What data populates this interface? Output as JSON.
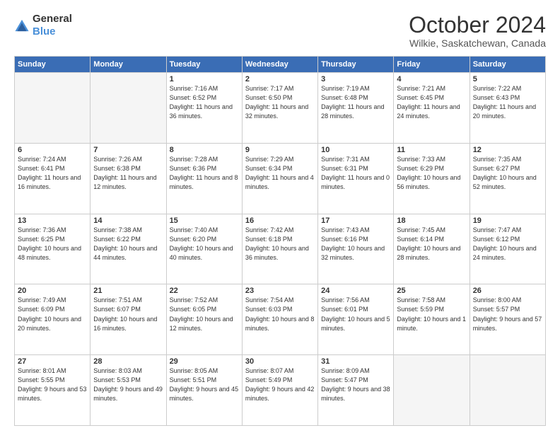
{
  "header": {
    "logo_general": "General",
    "logo_blue": "Blue",
    "month": "October 2024",
    "location": "Wilkie, Saskatchewan, Canada"
  },
  "weekdays": [
    "Sunday",
    "Monday",
    "Tuesday",
    "Wednesday",
    "Thursday",
    "Friday",
    "Saturday"
  ],
  "rows": [
    [
      {
        "day": "",
        "empty": true
      },
      {
        "day": "",
        "empty": true
      },
      {
        "day": "1",
        "sunrise": "7:16 AM",
        "sunset": "6:52 PM",
        "daylight": "11 hours and 36 minutes."
      },
      {
        "day": "2",
        "sunrise": "7:17 AM",
        "sunset": "6:50 PM",
        "daylight": "11 hours and 32 minutes."
      },
      {
        "day": "3",
        "sunrise": "7:19 AM",
        "sunset": "6:48 PM",
        "daylight": "11 hours and 28 minutes."
      },
      {
        "day": "4",
        "sunrise": "7:21 AM",
        "sunset": "6:45 PM",
        "daylight": "11 hours and 24 minutes."
      },
      {
        "day": "5",
        "sunrise": "7:22 AM",
        "sunset": "6:43 PM",
        "daylight": "11 hours and 20 minutes."
      }
    ],
    [
      {
        "day": "6",
        "sunrise": "7:24 AM",
        "sunset": "6:41 PM",
        "daylight": "11 hours and 16 minutes."
      },
      {
        "day": "7",
        "sunrise": "7:26 AM",
        "sunset": "6:38 PM",
        "daylight": "11 hours and 12 minutes."
      },
      {
        "day": "8",
        "sunrise": "7:28 AM",
        "sunset": "6:36 PM",
        "daylight": "11 hours and 8 minutes."
      },
      {
        "day": "9",
        "sunrise": "7:29 AM",
        "sunset": "6:34 PM",
        "daylight": "11 hours and 4 minutes."
      },
      {
        "day": "10",
        "sunrise": "7:31 AM",
        "sunset": "6:31 PM",
        "daylight": "11 hours and 0 minutes."
      },
      {
        "day": "11",
        "sunrise": "7:33 AM",
        "sunset": "6:29 PM",
        "daylight": "10 hours and 56 minutes."
      },
      {
        "day": "12",
        "sunrise": "7:35 AM",
        "sunset": "6:27 PM",
        "daylight": "10 hours and 52 minutes."
      }
    ],
    [
      {
        "day": "13",
        "sunrise": "7:36 AM",
        "sunset": "6:25 PM",
        "daylight": "10 hours and 48 minutes."
      },
      {
        "day": "14",
        "sunrise": "7:38 AM",
        "sunset": "6:22 PM",
        "daylight": "10 hours and 44 minutes."
      },
      {
        "day": "15",
        "sunrise": "7:40 AM",
        "sunset": "6:20 PM",
        "daylight": "10 hours and 40 minutes."
      },
      {
        "day": "16",
        "sunrise": "7:42 AM",
        "sunset": "6:18 PM",
        "daylight": "10 hours and 36 minutes."
      },
      {
        "day": "17",
        "sunrise": "7:43 AM",
        "sunset": "6:16 PM",
        "daylight": "10 hours and 32 minutes."
      },
      {
        "day": "18",
        "sunrise": "7:45 AM",
        "sunset": "6:14 PM",
        "daylight": "10 hours and 28 minutes."
      },
      {
        "day": "19",
        "sunrise": "7:47 AM",
        "sunset": "6:12 PM",
        "daylight": "10 hours and 24 minutes."
      }
    ],
    [
      {
        "day": "20",
        "sunrise": "7:49 AM",
        "sunset": "6:09 PM",
        "daylight": "10 hours and 20 minutes."
      },
      {
        "day": "21",
        "sunrise": "7:51 AM",
        "sunset": "6:07 PM",
        "daylight": "10 hours and 16 minutes."
      },
      {
        "day": "22",
        "sunrise": "7:52 AM",
        "sunset": "6:05 PM",
        "daylight": "10 hours and 12 minutes."
      },
      {
        "day": "23",
        "sunrise": "7:54 AM",
        "sunset": "6:03 PM",
        "daylight": "10 hours and 8 minutes."
      },
      {
        "day": "24",
        "sunrise": "7:56 AM",
        "sunset": "6:01 PM",
        "daylight": "10 hours and 5 minutes."
      },
      {
        "day": "25",
        "sunrise": "7:58 AM",
        "sunset": "5:59 PM",
        "daylight": "10 hours and 1 minute."
      },
      {
        "day": "26",
        "sunrise": "8:00 AM",
        "sunset": "5:57 PM",
        "daylight": "9 hours and 57 minutes."
      }
    ],
    [
      {
        "day": "27",
        "sunrise": "8:01 AM",
        "sunset": "5:55 PM",
        "daylight": "9 hours and 53 minutes."
      },
      {
        "day": "28",
        "sunrise": "8:03 AM",
        "sunset": "5:53 PM",
        "daylight": "9 hours and 49 minutes."
      },
      {
        "day": "29",
        "sunrise": "8:05 AM",
        "sunset": "5:51 PM",
        "daylight": "9 hours and 45 minutes."
      },
      {
        "day": "30",
        "sunrise": "8:07 AM",
        "sunset": "5:49 PM",
        "daylight": "9 hours and 42 minutes."
      },
      {
        "day": "31",
        "sunrise": "8:09 AM",
        "sunset": "5:47 PM",
        "daylight": "9 hours and 38 minutes."
      },
      {
        "day": "",
        "empty": true
      },
      {
        "day": "",
        "empty": true
      }
    ]
  ]
}
